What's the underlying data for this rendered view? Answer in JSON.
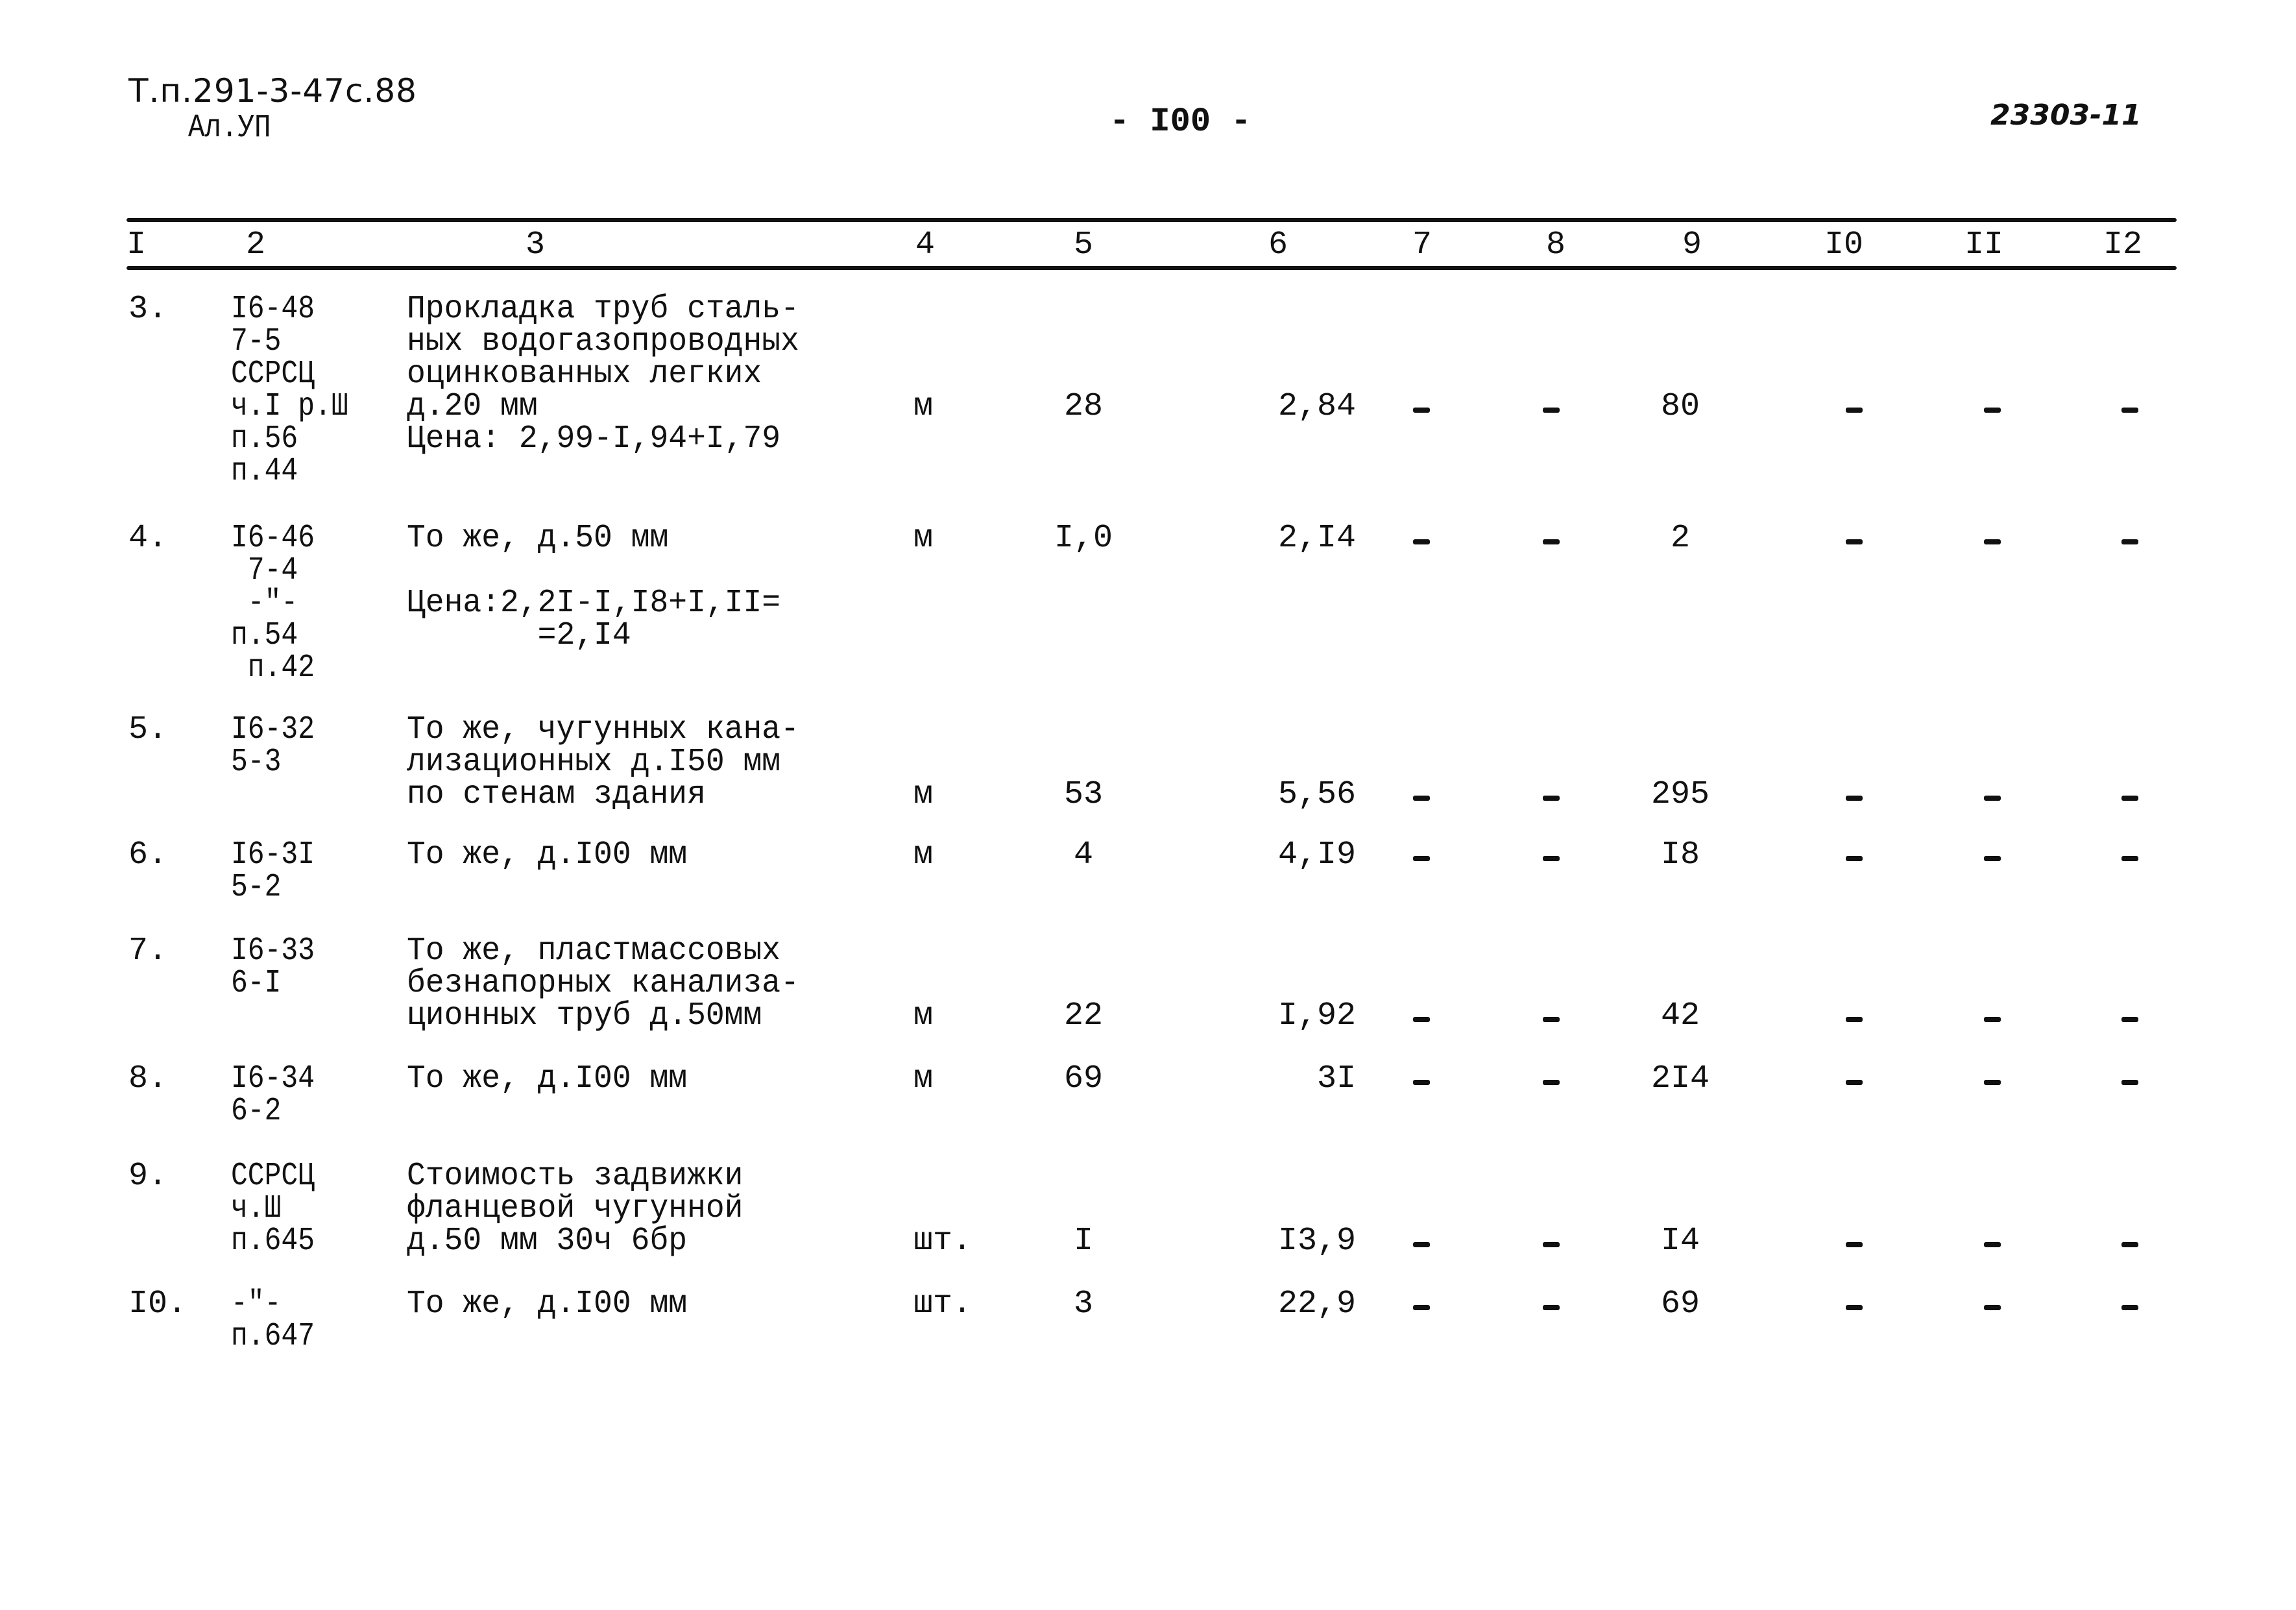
{
  "header": {
    "doc_code": "Т.п.291-3-47с.88",
    "album": "Ал.УП",
    "page_number": "- I00 -",
    "doc_number": "23303-11"
  },
  "table": {
    "column_headers": [
      "I",
      "2",
      "3",
      "4",
      "5",
      "6",
      "7",
      "8",
      "9",
      "I0",
      "II",
      "I2"
    ],
    "rows": [
      {
        "num": "3.",
        "code": "I6-48\n7-5\nССРСЦ\nч.I р.Ш\nп.56\nп.44",
        "description": "Прокладка труб сталь-\nных водогазопроводных\nоцинкованных легких\nд.20 мм\nЦена: 2,99-I,94+I,79",
        "unit": "м",
        "quantity": "28",
        "price": "2,84",
        "col7": "-",
        "col8": "-",
        "total": "80",
        "col10": "-",
        "col11": "-",
        "col12": "-"
      },
      {
        "num": "4.",
        "code": "I6-46\n 7-4\n -\"-\nп.54\n п.42",
        "description": "То же, д.50 мм\n\nЦена:2,2I-I,I8+I,II=\n       =2,I4",
        "unit": "м",
        "quantity": "I,0",
        "price": "2,I4",
        "col7": "-",
        "col8": "-",
        "total": "2",
        "col10": "-",
        "col11": "-",
        "col12": "-"
      },
      {
        "num": "5.",
        "code": "I6-32\n5-3",
        "description": "То же, чугунных кана-\nлизационных д.I50 мм\nпо стенам здания",
        "unit": "м",
        "quantity": "53",
        "price": "5,56",
        "col7": "-",
        "col8": "-",
        "total": "295",
        "col10": "-",
        "col11": "-",
        "col12": "-"
      },
      {
        "num": "6.",
        "code": "I6-3I\n5-2",
        "description": "То же, д.I00 мм",
        "unit": "м",
        "quantity": "4",
        "price": "4,I9",
        "col7": "-",
        "col8": "-",
        "total": "I8",
        "col10": "-",
        "col11": "-",
        "col12": "-"
      },
      {
        "num": "7.",
        "code": "I6-33\n6-I",
        "description": "То же, пластмассовых\nбезнапорных канализа-\nционных труб д.50мм",
        "unit": "м",
        "quantity": "22",
        "price": "I,92",
        "col7": "-",
        "col8": "-",
        "total": "42",
        "col10": "-",
        "col11": "-",
        "col12": "-"
      },
      {
        "num": "8.",
        "code": "I6-34\n6-2",
        "description": "То же, д.I00 мм",
        "unit": "м",
        "quantity": "69",
        "price": "3I",
        "col7": "-",
        "col8": "-",
        "total": "2I4",
        "col10": "-",
        "col11": "-",
        "col12": "-"
      },
      {
        "num": "9.",
        "code": "ССРСЦ\nч.Ш\nп.645",
        "description": "Стоимость задвижки\nфланцевой чугунной\nд.50 мм 30ч 6бр",
        "unit": "шт.",
        "quantity": "I",
        "price": "I3,9",
        "col7": "-",
        "col8": "-",
        "total": "I4",
        "col10": "-",
        "col11": "-",
        "col12": "-"
      },
      {
        "num": "I0.",
        "code": "-\"-\nп.647",
        "description": "То же, д.I00 мм",
        "unit": "шт.",
        "quantity": "3",
        "price": "22,9",
        "col7": "-",
        "col8": "-",
        "total": "69",
        "col10": "-",
        "col11": "-",
        "col12": "-"
      }
    ]
  }
}
